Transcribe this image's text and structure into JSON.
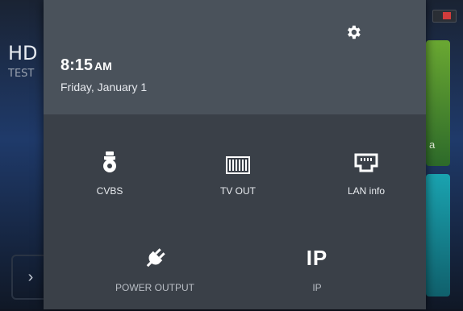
{
  "background_app": {
    "title": "HD",
    "subtitle": "TEST",
    "green_tile_letter": "a"
  },
  "status_bar": {
    "time": "8:15",
    "ampm": "AM",
    "date": "Friday, January 1"
  },
  "quick_settings": [
    {
      "id": "cvbs",
      "label": "CVBS",
      "icon": "ptz-camera-icon"
    },
    {
      "id": "tvout",
      "label": "TV OUT",
      "icon": "tv-out-icon"
    },
    {
      "id": "lan",
      "label": "LAN info",
      "icon": "ethernet-port-icon"
    },
    {
      "id": "power",
      "label": "POWER OUTPUT",
      "icon": "plug-icon"
    },
    {
      "id": "ip",
      "label": "IP",
      "icon_text": "IP"
    }
  ],
  "colors": {
    "shade_bg": "#3a4048",
    "header_bg": "#4a525b",
    "text": "#ffffff"
  }
}
